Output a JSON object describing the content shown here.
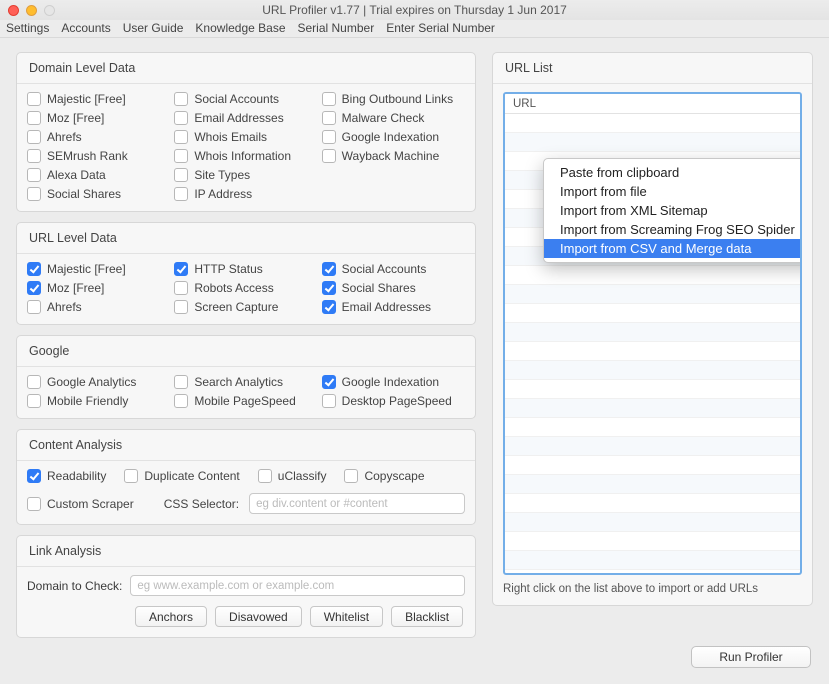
{
  "window": {
    "title": "URL Profiler v1.77 | Trial expires on Thursday 1 Jun 2017"
  },
  "menubar": [
    "Settings",
    "Accounts",
    "User Guide",
    "Knowledge Base",
    "Serial Number",
    "Enter Serial Number"
  ],
  "panels": {
    "domain": {
      "title": "Domain Level Data",
      "items": [
        {
          "label": "Majestic [Free]",
          "checked": false
        },
        {
          "label": "Social Accounts",
          "checked": false
        },
        {
          "label": "Bing Outbound Links",
          "checked": false
        },
        {
          "label": "Moz [Free]",
          "checked": false
        },
        {
          "label": "Email Addresses",
          "checked": false
        },
        {
          "label": "Malware Check",
          "checked": false
        },
        {
          "label": "Ahrefs",
          "checked": false
        },
        {
          "label": "Whois Emails",
          "checked": false
        },
        {
          "label": "Google Indexation",
          "checked": false
        },
        {
          "label": "SEMrush Rank",
          "checked": false
        },
        {
          "label": "Whois Information",
          "checked": false
        },
        {
          "label": "Wayback Machine",
          "checked": false
        },
        {
          "label": "Alexa Data",
          "checked": false
        },
        {
          "label": "Site Types",
          "checked": false
        },
        {
          "label": "",
          "checked": false,
          "empty": true
        },
        {
          "label": "Social Shares",
          "checked": false
        },
        {
          "label": "IP Address",
          "checked": false
        }
      ]
    },
    "url": {
      "title": "URL Level Data",
      "items": [
        {
          "label": "Majestic [Free]",
          "checked": true
        },
        {
          "label": "HTTP Status",
          "checked": true
        },
        {
          "label": "Social Accounts",
          "checked": true
        },
        {
          "label": "Moz [Free]",
          "checked": true
        },
        {
          "label": "Robots Access",
          "checked": false
        },
        {
          "label": "Social Shares",
          "checked": true
        },
        {
          "label": "Ahrefs",
          "checked": false
        },
        {
          "label": "Screen Capture",
          "checked": false
        },
        {
          "label": "Email Addresses",
          "checked": true
        }
      ]
    },
    "google": {
      "title": "Google",
      "items": [
        {
          "label": "Google Analytics",
          "checked": false
        },
        {
          "label": "Search Analytics",
          "checked": false
        },
        {
          "label": "Google Indexation",
          "checked": true
        },
        {
          "label": "Mobile Friendly",
          "checked": false
        },
        {
          "label": "Mobile PageSpeed",
          "checked": false
        },
        {
          "label": "Desktop PageSpeed",
          "checked": false
        }
      ]
    },
    "content": {
      "title": "Content Analysis",
      "row1": [
        {
          "label": "Readability",
          "checked": true
        },
        {
          "label": "Duplicate Content",
          "checked": false
        },
        {
          "label": "uClassify",
          "checked": false
        },
        {
          "label": "Copyscape",
          "checked": false
        }
      ],
      "custom_scraper": {
        "label": "Custom Scraper",
        "checked": false
      },
      "css_selector_label": "CSS Selector:",
      "css_selector_placeholder": "eg div.content or #content"
    },
    "link": {
      "title": "Link Analysis",
      "domain_label": "Domain to Check:",
      "domain_placeholder": "eg www.example.com or example.com",
      "buttons": [
        "Anchors",
        "Disavowed",
        "Whitelist",
        "Blacklist"
      ]
    }
  },
  "urllist": {
    "panel_title": "URL List",
    "header": "URL",
    "footer": "Right click on the list above to import or add URLs",
    "context": [
      {
        "label": "Paste from clipboard",
        "sel": false
      },
      {
        "label": "Import from file",
        "sel": false
      },
      {
        "label": "Import from XML Sitemap",
        "sel": false
      },
      {
        "label": "Import from Screaming Frog SEO Spider",
        "sel": false
      },
      {
        "label": "Import from CSV and Merge data",
        "sel": true
      }
    ]
  },
  "run_button": "Run Profiler"
}
